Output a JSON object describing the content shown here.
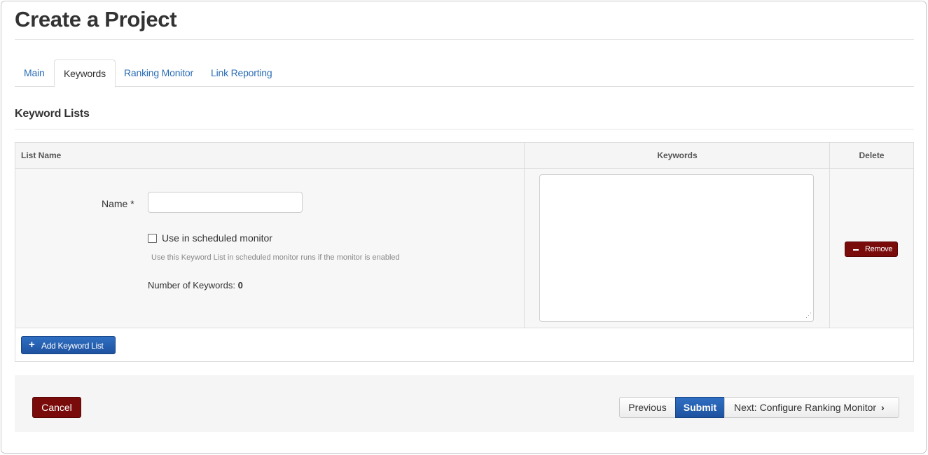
{
  "page": {
    "title": "Create a Project"
  },
  "tabs": [
    {
      "label": "Main",
      "active": false
    },
    {
      "label": "Keywords",
      "active": true
    },
    {
      "label": "Ranking Monitor",
      "active": false
    },
    {
      "label": "Link Reporting",
      "active": false
    }
  ],
  "section": {
    "title": "Keyword Lists"
  },
  "table": {
    "headers": {
      "list_name": "List Name",
      "keywords": "Keywords",
      "delete": "Delete"
    },
    "row": {
      "name_label": "Name *",
      "name_value": "",
      "use_in_monitor_label": "Use in scheduled monitor",
      "use_in_monitor_checked": false,
      "help_text": "Use this Keyword List in scheduled monitor runs if the monitor is enabled",
      "count_label": "Number of Keywords:",
      "count_value": "0",
      "keywords_value": "",
      "remove_label": "Remove"
    },
    "add_label": "Add Keyword List"
  },
  "footer": {
    "cancel_label": "Cancel",
    "previous_label": "Previous",
    "submit_label": "Submit",
    "next_label": "Next: Configure Ranking Monitor"
  },
  "icons": {
    "remove": "minus-icon",
    "add": "plus-icon",
    "next": "chevron-right-icon"
  },
  "colors": {
    "primary": "#1e52a0",
    "danger": "#7a0b0b",
    "link": "#2a6db5"
  }
}
